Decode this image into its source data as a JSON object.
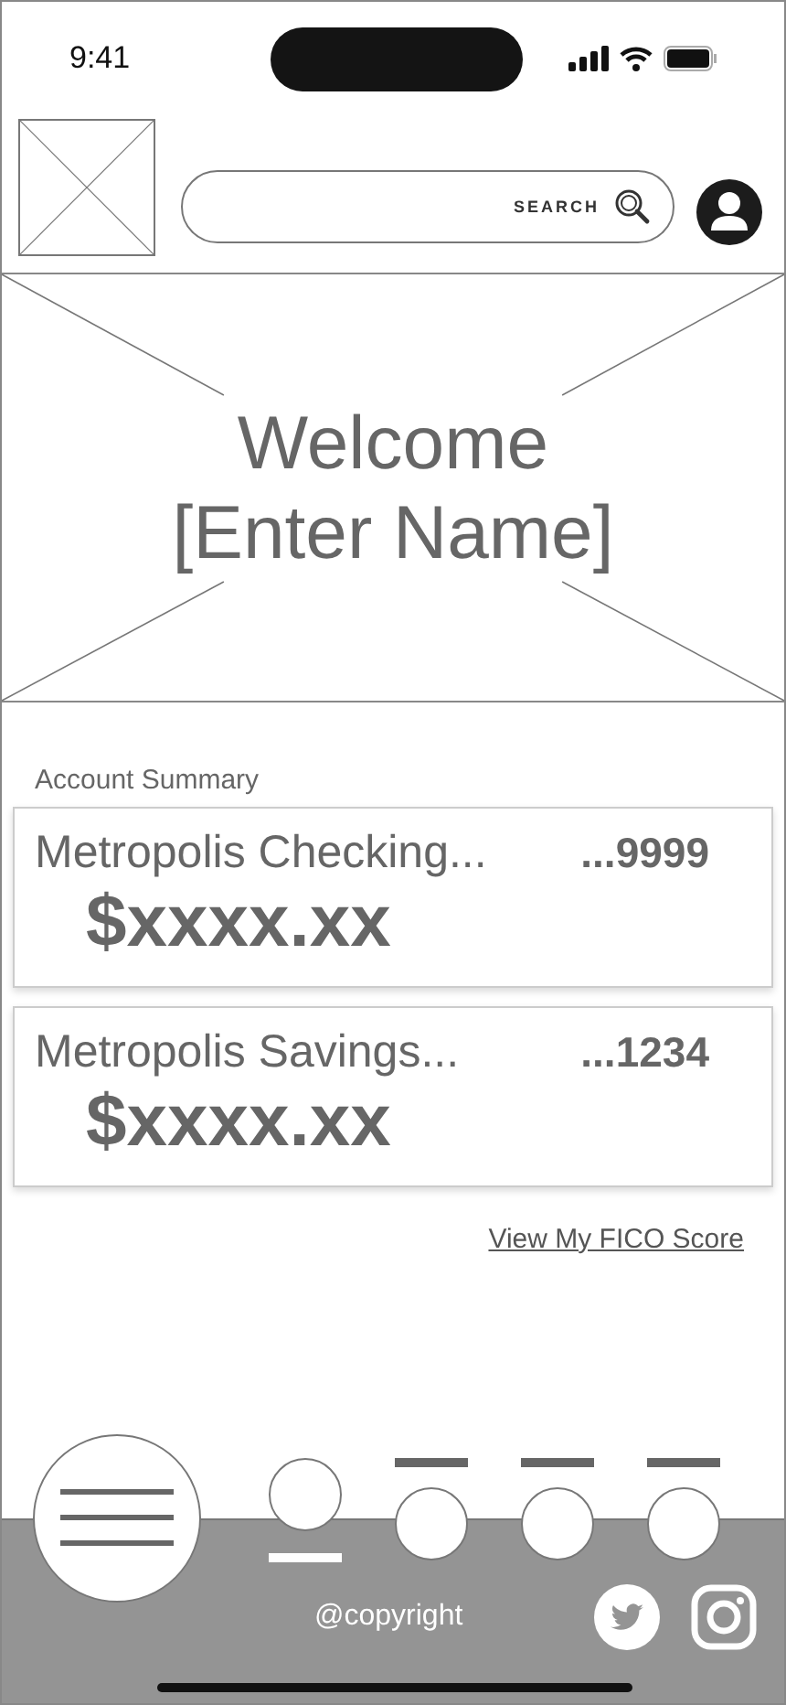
{
  "status_bar": {
    "time": "9:41"
  },
  "header": {
    "search": {
      "label": "SEARCH"
    }
  },
  "hero": {
    "greeting": "Welcome",
    "name_placeholder": "[Enter Name]"
  },
  "account_summary": {
    "title": "Account Summary",
    "accounts": [
      {
        "name": "Metropolis Checking...",
        "number": "...9999",
        "balance": "$xxxx.xx"
      },
      {
        "name": "Metropolis Savings...",
        "number": "...1234",
        "balance": "$xxxx.xx"
      }
    ]
  },
  "fico_link": "View My FICO Score",
  "bottom_nav": {
    "tabs": [
      {
        "selected": true
      },
      {
        "selected": false
      },
      {
        "selected": false
      },
      {
        "selected": false
      }
    ]
  },
  "footer": {
    "copyright": "@copyright"
  }
}
